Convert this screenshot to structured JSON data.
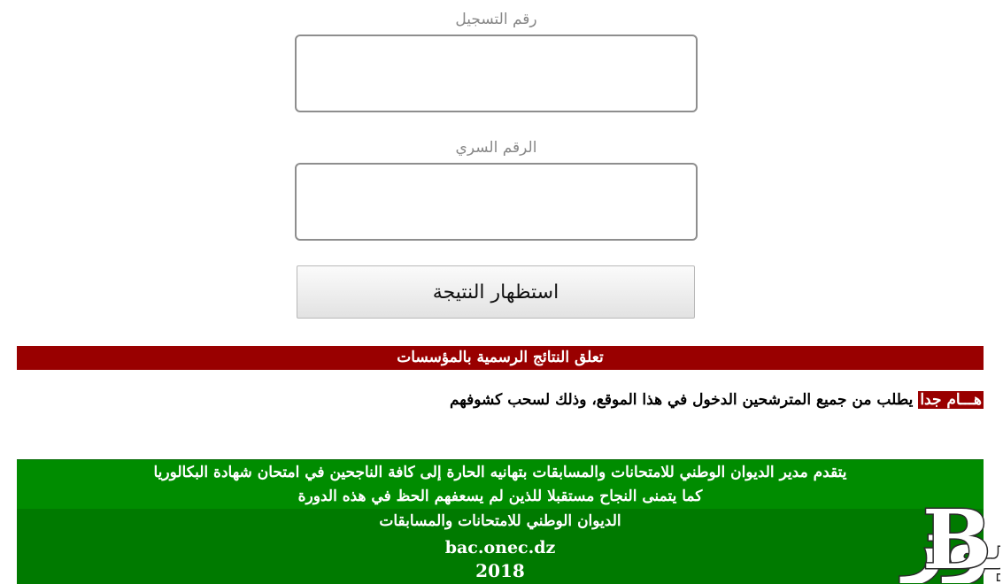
{
  "form": {
    "registration_label": "رقم التسجيل",
    "registration_value": "",
    "password_label": "الرقم السري",
    "password_value": "",
    "submit_label": "استظهار النتيجة"
  },
  "banner": {
    "text": "تعلق النتائج الرسمية بالمؤسسات",
    "color": "#990000"
  },
  "notice": {
    "badge": "هـــام جدا",
    "text": " يطلب من جميع المترشحين الدخول في هذا الموقع، وذلك لسحب كشوفهم"
  },
  "congrats": {
    "line1": "يتقدم مدير الديوان الوطني للامتحانات والمسابقات بتهانيه الحارة إلى كافة الناجحين في امتحان شهادة البكالوريا",
    "line2": "كما يتمنى النجاح مستقبلا للذين لم يسعفهم الحظ في هذه الدورة",
    "line3": "الديوان الوطني للامتحانات والمسابقات",
    "site": "bac.onec.dz",
    "year": "2018",
    "color": "#008c00"
  },
  "watermark": {
    "text": "بلد نيوز",
    "logo_letter": "B"
  }
}
